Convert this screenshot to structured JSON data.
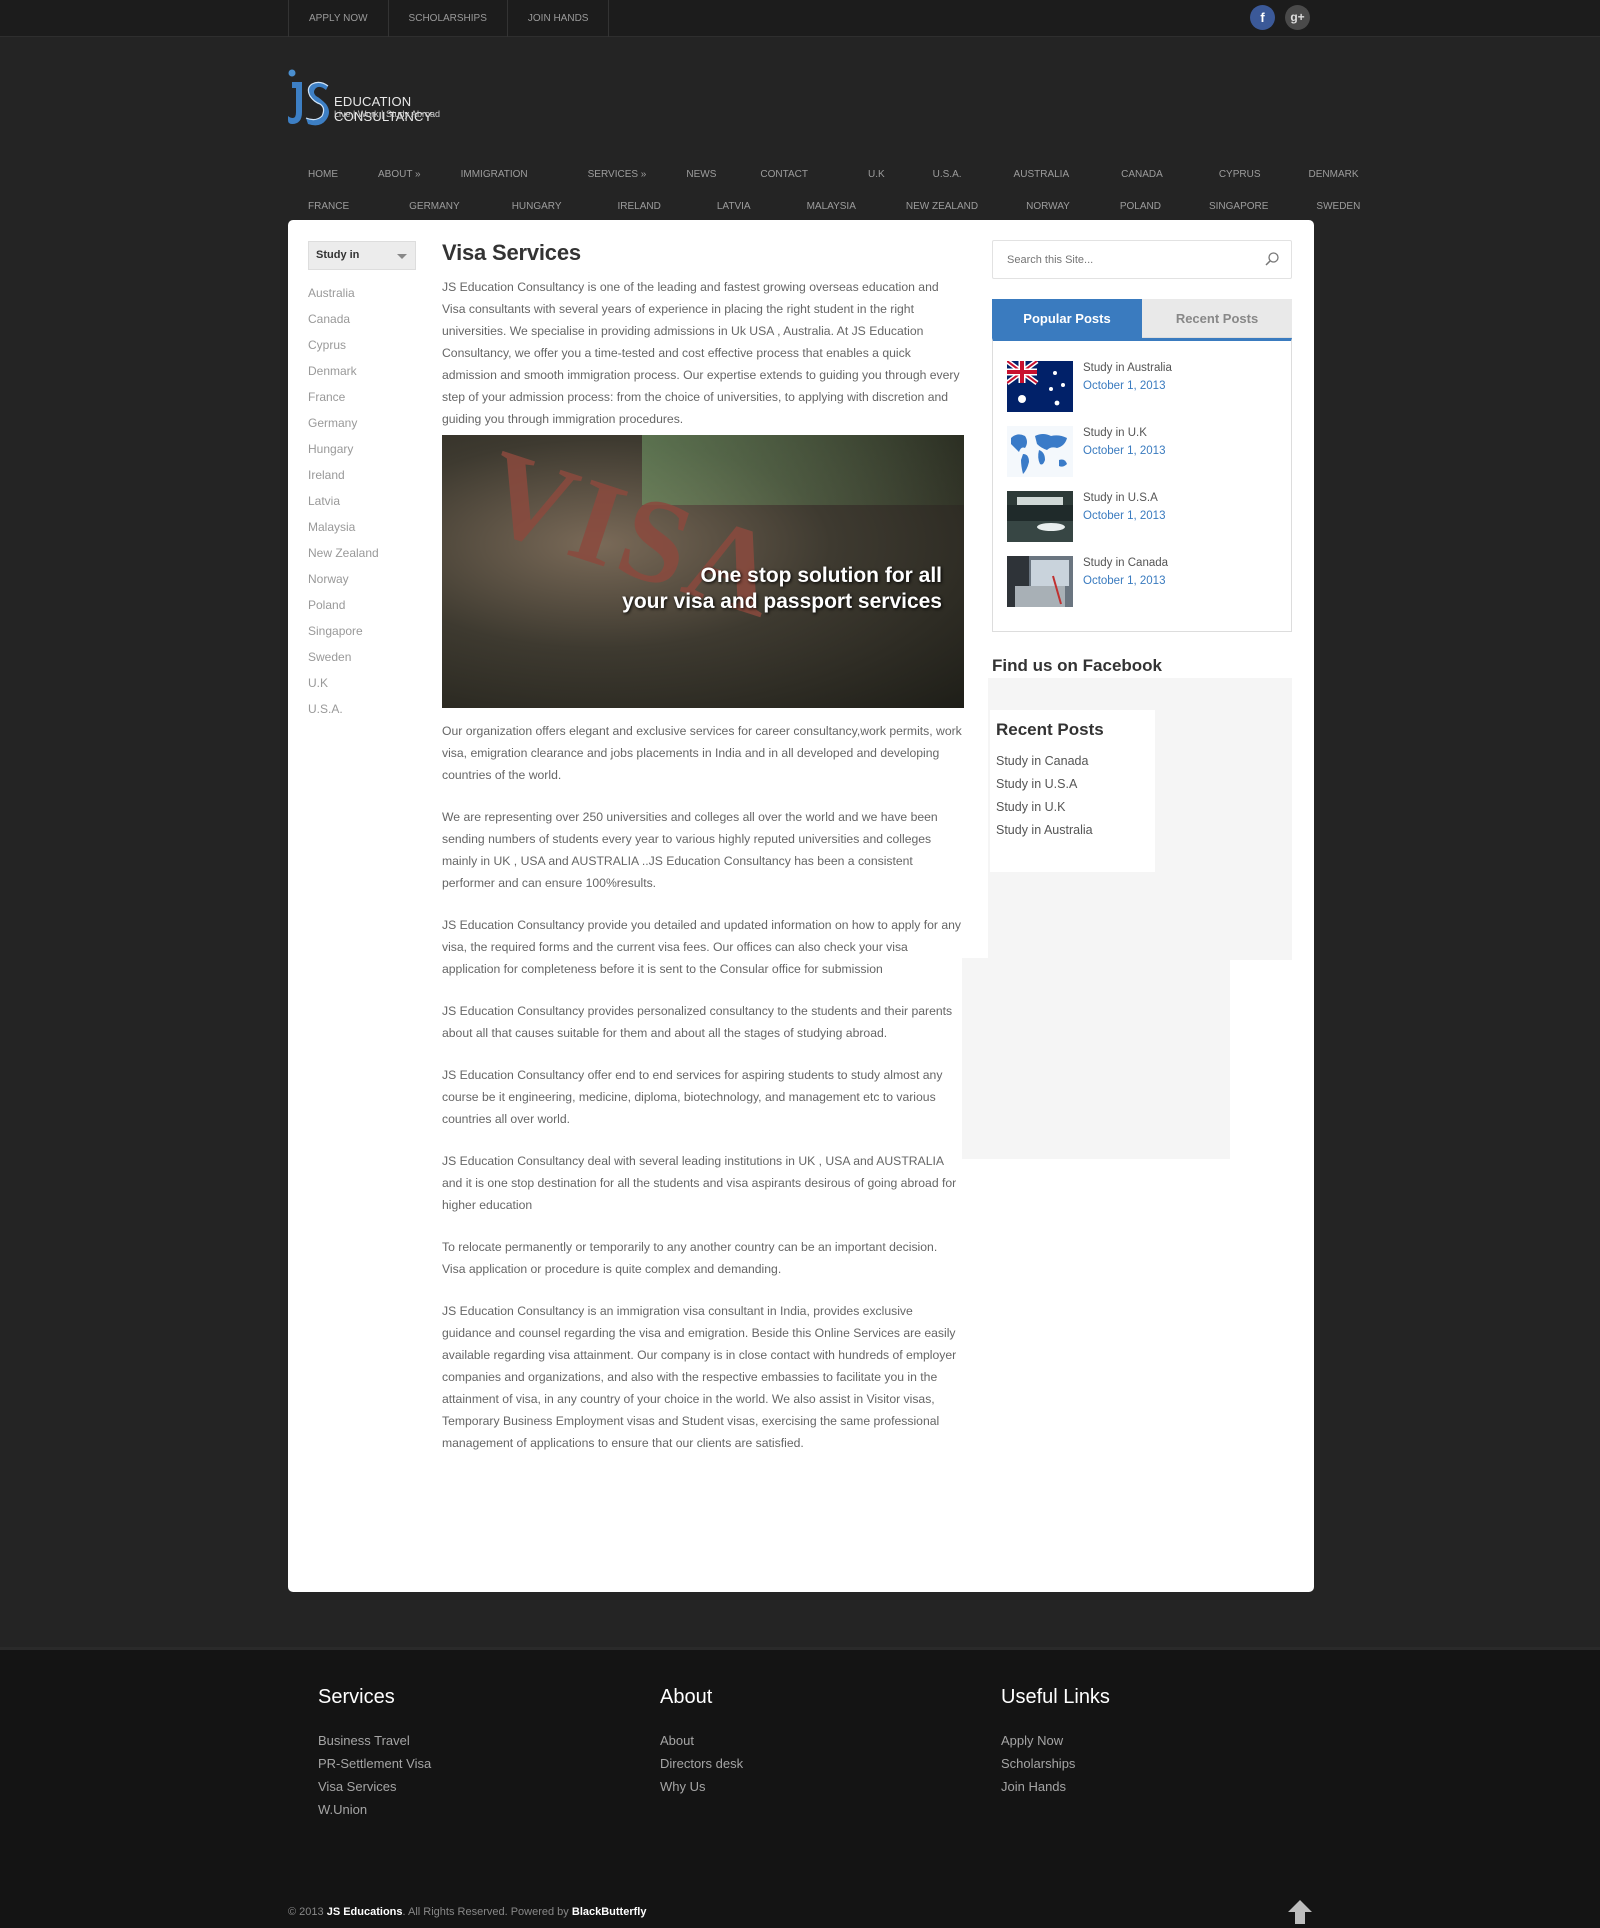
{
  "topbar": {
    "links": [
      "APPLY NOW",
      "SCHOLARSHIPS",
      "JOIN HANDS"
    ],
    "social": [
      {
        "name": "facebook-icon",
        "glyph": "f"
      },
      {
        "name": "google-plus-icon",
        "glyph": "g+"
      }
    ]
  },
  "logo": {
    "title": "EDUCATION CONSULTANCY",
    "tagline": "Live | Work | Study Abroad"
  },
  "nav": {
    "row1": [
      "HOME",
      "ABOUT »",
      "IMMIGRATION",
      "SERVICES »",
      "NEWS",
      "CONTACT",
      "U.K",
      "U.S.A.",
      "AUSTRALIA",
      "CANADA",
      "CYPRUS",
      "DENMARK"
    ],
    "row2": [
      "FRANCE",
      "GERMANY",
      "HUNGARY",
      "IRELAND",
      "LATVIA",
      "MALAYSIA",
      "NEW ZEALAND",
      "NORWAY",
      "POLAND",
      "SINGAPORE",
      "SWEDEN"
    ]
  },
  "leftnav": {
    "dropdown": "Study in",
    "items": [
      "Australia",
      "Canada",
      "Cyprus",
      "Denmark",
      "France",
      "Germany",
      "Hungary",
      "Ireland",
      "Latvia",
      "Malaysia",
      "New Zealand",
      "Norway",
      "Poland",
      "Singapore",
      "Sweden",
      "U.K",
      "U.S.A."
    ]
  },
  "main": {
    "title": "Visa Services",
    "intro": "JS Education Consultancy is one of the leading and fastest growing overseas education and Visa consultants with several years of experience in placing the right student in the right universities. We specialise in providing admissions in Uk USA , Australia. At JS Education Consultancy, we offer you a time-tested and cost effective process that enables a quick admission and smooth immigration process. Our expertise extends to guiding you through every step of your admission process: from the choice of universities, to applying with discretion and guiding you through immigration procedures.",
    "image_caption_line1": "One stop solution for all",
    "image_caption_line2": "your visa and passport services",
    "paragraphs": [
      "Our organization offers elegant and exclusive services for career consultancy,work permits, work visa, emigration clearance and jobs placements in India and in all developed and developing countries of the world.",
      "We are representing over 250 universities and colleges all over the world and we have been sending numbers of students every year to various highly reputed universities and colleges mainly in UK , USA and AUSTRALIA ..JS Education Consultancy has been a consistent performer and can ensure 100%results.",
      "JS Education Consultancy provide you detailed and updated information on how to apply for any visa, the required forms and the current visa fees. Our offices can also check your visa application for completeness before it is sent to the Consular office for submission",
      "JS Education Consultancy provides personalized consultancy to the students and their parents about all that causes suitable for them and about all the stages of studying abroad.",
      "JS Education Consultancy offer end to end services for aspiring students to study almost any course be it engineering, medicine, diploma, biotechnology, and management etc to various countries all over world.",
      "JS Education Consultancy deal with several leading institutions in UK , USA and AUSTRALIA and it is one stop destination for all the students and visa aspirants desirous of going abroad for higher education",
      "To relocate permanently or temporarily to any another country can be an important decision. Visa application or procedure is quite complex and demanding.",
      "JS Education Consultancy is an immigration visa consultant in India, provides exclusive guidance and counsel regarding the visa and emigration. Beside this Online Services are easily available regarding visa attainment. Our company is in close contact with hundreds of employer companies and organizations, and also with the respective embassies to facilitate you in the attainment of visa, in any country of your choice in the world. We also assist in Visitor visas, Temporary Business Employment visas and Student visas, exercising the same professional management of applications to ensure that our clients are satisfied."
    ]
  },
  "sidebar": {
    "search_placeholder": "Search this Site...",
    "tabs": {
      "popular": "Popular Posts",
      "recent": "Recent Posts"
    },
    "posts": [
      {
        "title": "Study in Australia",
        "date": "October 1, 2013"
      },
      {
        "title": "Study in U.K",
        "date": "October 1, 2013"
      },
      {
        "title": "Study in U.S.A",
        "date": "October 1, 2013"
      },
      {
        "title": "Study in Canada",
        "date": "October 1, 2013"
      }
    ],
    "facebook_title": "Find us on Facebook",
    "recent_title": "Recent Posts",
    "recent": [
      "Study in Canada",
      "Study in U.S.A",
      "Study in U.K",
      "Study in Australia"
    ]
  },
  "footer": {
    "services": {
      "title": "Services",
      "items": [
        "Business Travel",
        "PR-Settlement Visa",
        "Visa Services",
        "W.Union"
      ]
    },
    "about": {
      "title": "About",
      "items": [
        "About",
        "Directors desk",
        "Why Us"
      ]
    },
    "links": {
      "title": "Useful Links",
      "items": [
        "Apply Now",
        "Scholarships",
        "Join Hands"
      ]
    },
    "copyright_prefix": "© 2013",
    "brand": "JS Educations",
    "copyright_mid": ". All Rights Reserved. Powered by",
    "powered": "BlackButterfly"
  }
}
